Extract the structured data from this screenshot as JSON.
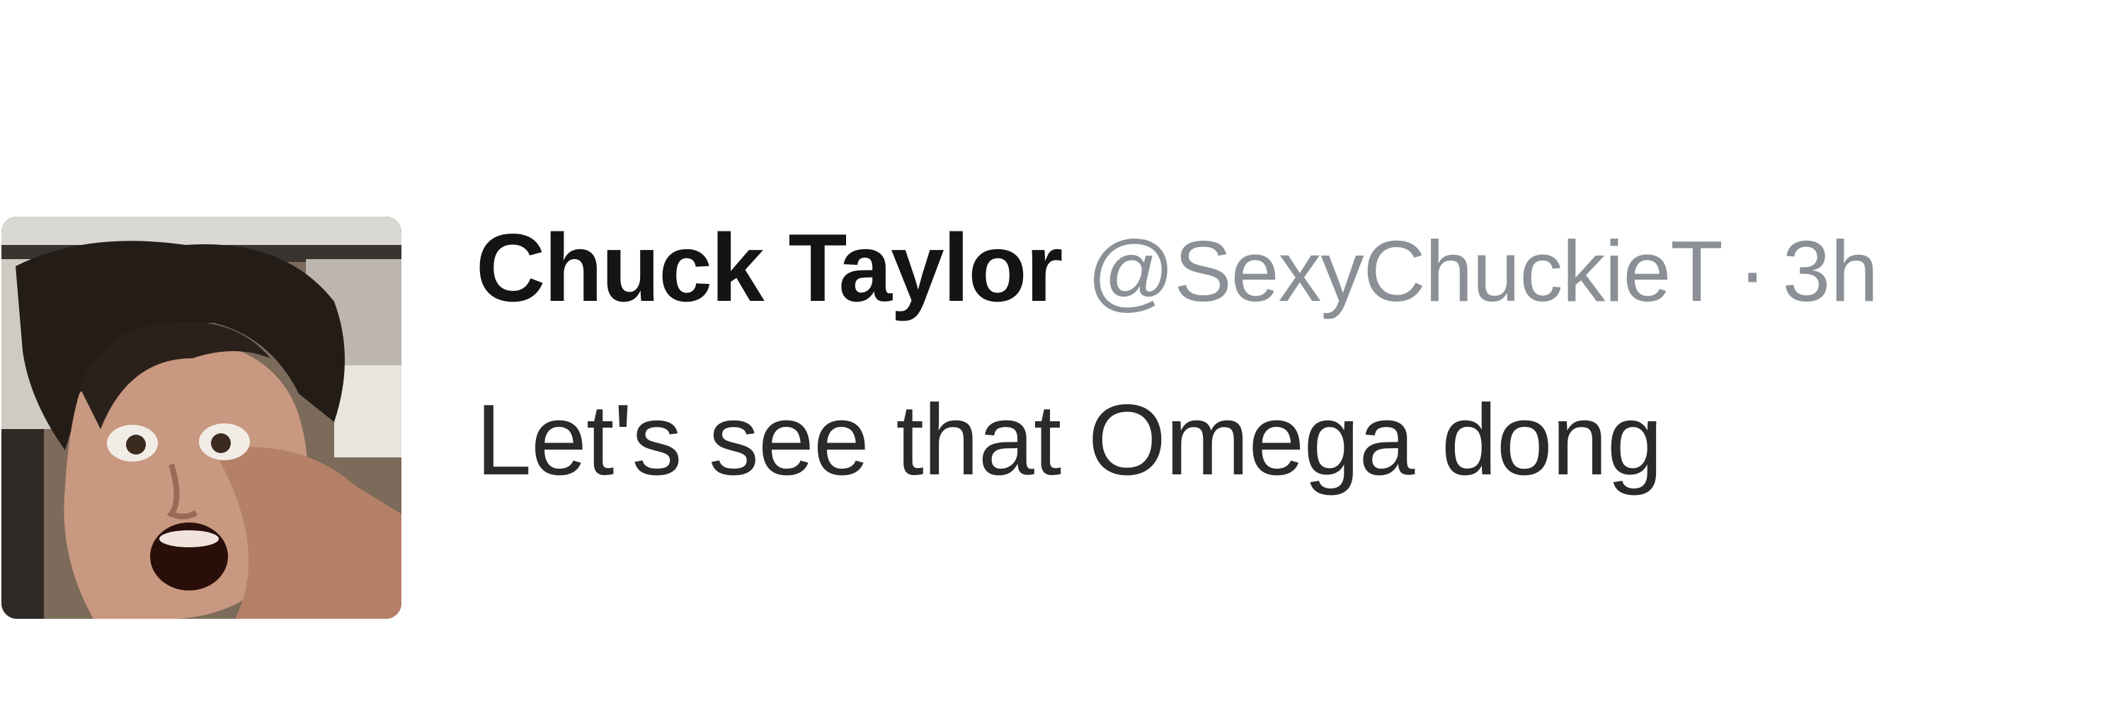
{
  "tweet": {
    "display_name": "Chuck Taylor",
    "handle": "@SexyChuckieT",
    "separator": "·",
    "time": "3h",
    "text": "Let's see that Omega dong"
  },
  "avatar": {
    "icon": "profile-photo"
  },
  "colors": {
    "name": "#141414",
    "meta": "#8b9096",
    "text": "#2a2a2a",
    "background": "#ffffff"
  }
}
